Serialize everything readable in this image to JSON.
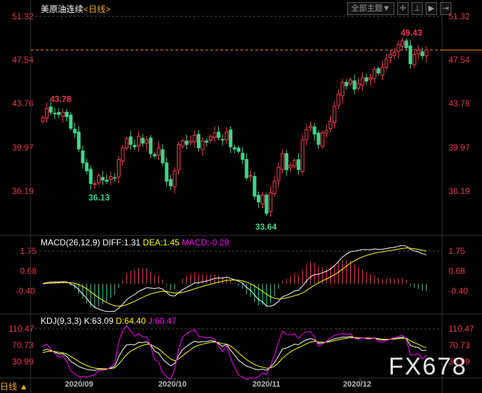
{
  "header": {
    "title": "美原油连续",
    "period": "<日线>",
    "theme_button": "全部主题▼",
    "tool_icons": [
      "crosshair-icon",
      "range-icon",
      "play-icon",
      "next-icon"
    ]
  },
  "price_axis": [
    "51.32",
    "47.54",
    "43.76",
    "39.97",
    "36.19"
  ],
  "annotations": {
    "high": "49.43",
    "low": "33.64",
    "left_high": "43.78",
    "left_low": "36.13"
  },
  "macd": {
    "label": "MACD(26,12,9)",
    "diff": "DIFF:1.31",
    "dea": "DEA:1.45",
    "macd": "MACD:-0.28",
    "axis": [
      "1.75",
      "0.68",
      "-0.40"
    ]
  },
  "kdj": {
    "label": "KDJ(9,3,3)",
    "k": "K:63.09",
    "d": "D:64.40",
    "j": "J:60.47",
    "axis": [
      "110.47",
      "70.73",
      "30.99"
    ]
  },
  "dates": [
    "2020/09",
    "2020/10",
    "2020/11",
    "2020/12"
  ],
  "period_button": "日线 ▲",
  "watermark": "FX678",
  "colors": {
    "up": "#ff3b4f",
    "down": "#3fd38a",
    "diff": "#ffffff",
    "dea": "#ffff00",
    "j": "#ff00ff",
    "axis_text": "#e8374e",
    "current_line": "#ff8c1a"
  },
  "chart_data": {
    "type": "candlestick",
    "closes": [
      42.5,
      43.3,
      43.0,
      42.9,
      42.8,
      43.0,
      42.6,
      41.6,
      41.2,
      39.8,
      38.6,
      37.9,
      36.8,
      36.8,
      37.5,
      37.1,
      37.0,
      37.4,
      37.3,
      38.9,
      39.9,
      40.7,
      40.2,
      40.0,
      40.9,
      40.3,
      40.6,
      39.4,
      39.2,
      39.9,
      38.6,
      37.0,
      36.6,
      37.9,
      40.2,
      40.5,
      40.2,
      40.5,
      41.0,
      39.9,
      40.5,
      40.4,
      40.9,
      41.2,
      40.8,
      40.6,
      41.3,
      40.0,
      39.8,
      39.6,
      38.9,
      37.3,
      37.5,
      35.7,
      35.2,
      35.8,
      34.2,
      36.0,
      37.0,
      38.2,
      39.4,
      38.0,
      38.4,
      38.8,
      38.0,
      40.6,
      41.5,
      41.8,
      41.1,
      40.2,
      41.2,
      41.4,
      42.2,
      43.5,
      44.6,
      45.6,
      45.3,
      45.8,
      45.0,
      45.5,
      46.0,
      45.7,
      46.0,
      46.7,
      46.4,
      46.9,
      47.6,
      48.0,
      48.2,
      48.9,
      49.2,
      48.6,
      47.2,
      48.0,
      48.4,
      47.9,
      48.4
    ],
    "ylim": [
      34.0,
      51.32
    ],
    "current": 48.4
  }
}
